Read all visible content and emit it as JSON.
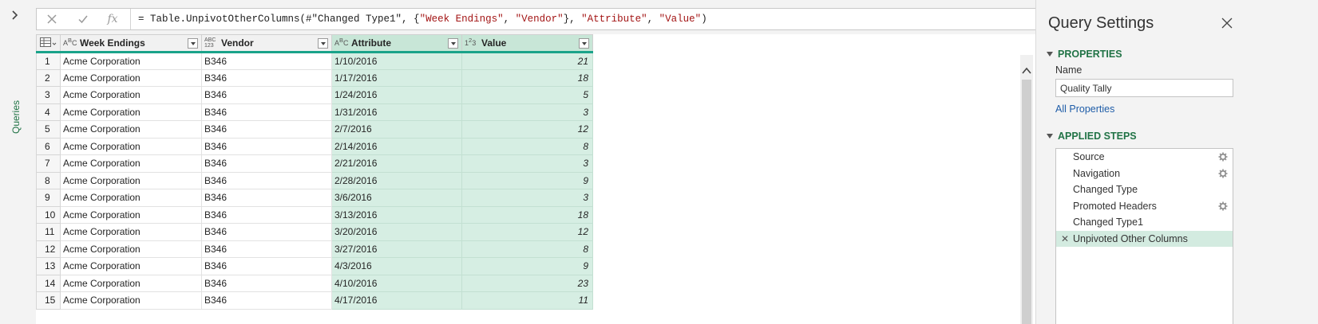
{
  "queries_pane": {
    "label": "Queries"
  },
  "formula_bar": {
    "cancel_icon": "close-icon",
    "commit_icon": "check-icon",
    "fx_label": "fx",
    "prefix": "= Table.UnpivotOtherColumns(#\"Changed Type1\", {",
    "s1": "\"Week Endings\"",
    "sep1": ", ",
    "s2": "\"Vendor\"",
    "mid": "}, ",
    "s3": "\"Attribute\"",
    "sep2": ", ",
    "s4": "\"Value\"",
    "suffix": ")"
  },
  "grid": {
    "columns": [
      {
        "name": "Week Endings",
        "type": "ABC",
        "selected": false
      },
      {
        "name": "Vendor",
        "type": "ABC123",
        "selected": false
      },
      {
        "name": "Attribute",
        "type": "ABC",
        "selected": true
      },
      {
        "name": "Value",
        "type": "123",
        "selected": true
      }
    ],
    "rows": [
      [
        "1",
        "Acme Corporation",
        "B346",
        "1/10/2016",
        "21"
      ],
      [
        "2",
        "Acme Corporation",
        "B346",
        "1/17/2016",
        "18"
      ],
      [
        "3",
        "Acme Corporation",
        "B346",
        "1/24/2016",
        "5"
      ],
      [
        "4",
        "Acme Corporation",
        "B346",
        "1/31/2016",
        "3"
      ],
      [
        "5",
        "Acme Corporation",
        "B346",
        "2/7/2016",
        "12"
      ],
      [
        "6",
        "Acme Corporation",
        "B346",
        "2/14/2016",
        "8"
      ],
      [
        "7",
        "Acme Corporation",
        "B346",
        "2/21/2016",
        "3"
      ],
      [
        "8",
        "Acme Corporation",
        "B346",
        "2/28/2016",
        "9"
      ],
      [
        "9",
        "Acme Corporation",
        "B346",
        "3/6/2016",
        "3"
      ],
      [
        "10",
        "Acme Corporation",
        "B346",
        "3/13/2016",
        "18"
      ],
      [
        "11",
        "Acme Corporation",
        "B346",
        "3/20/2016",
        "12"
      ],
      [
        "12",
        "Acme Corporation",
        "B346",
        "3/27/2016",
        "8"
      ],
      [
        "13",
        "Acme Corporation",
        "B346",
        "4/3/2016",
        "9"
      ],
      [
        "14",
        "Acme Corporation",
        "B346",
        "4/10/2016",
        "23"
      ],
      [
        "15",
        "Acme Corporation",
        "B346",
        "4/17/2016",
        "11"
      ]
    ]
  },
  "query_settings": {
    "title": "Query Settings",
    "properties_header": "PROPERTIES",
    "name_label": "Name",
    "name_value": "Quality Tally",
    "all_properties_link": "All Properties",
    "applied_steps_header": "APPLIED STEPS",
    "steps": [
      {
        "label": "Source",
        "has_gear": true,
        "active": false
      },
      {
        "label": "Navigation",
        "has_gear": true,
        "active": false
      },
      {
        "label": "Changed Type",
        "has_gear": false,
        "active": false
      },
      {
        "label": "Promoted Headers",
        "has_gear": true,
        "active": false
      },
      {
        "label": "Changed Type1",
        "has_gear": false,
        "active": false
      },
      {
        "label": "Unpivoted Other Columns",
        "has_gear": false,
        "active": true
      }
    ]
  },
  "colors": {
    "accent_green": "#217346",
    "selected_column": "#d6eee3",
    "header_underline": "#1aa38a",
    "link_blue": "#1f5da8"
  }
}
